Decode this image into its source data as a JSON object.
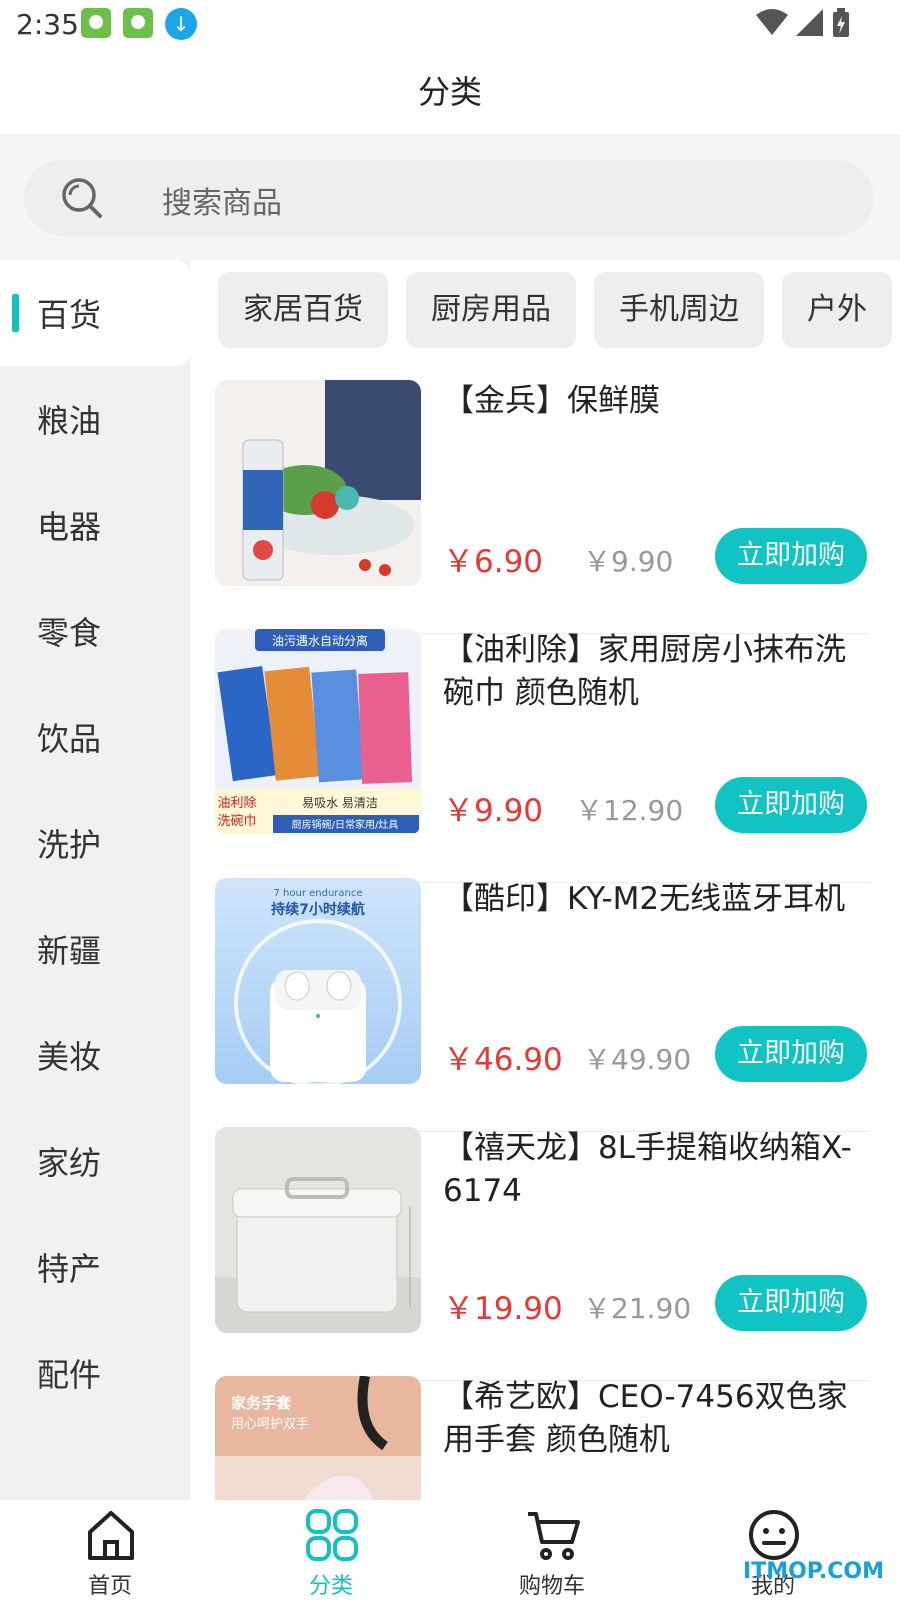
{
  "status": {
    "time": "2:35"
  },
  "header": {
    "title": "分类"
  },
  "search": {
    "placeholder": "搜索商品"
  },
  "sidebar": {
    "items": [
      {
        "label": "百货",
        "active": true
      },
      {
        "label": "粮油"
      },
      {
        "label": "电器"
      },
      {
        "label": "零食"
      },
      {
        "label": "饮品"
      },
      {
        "label": "洗护"
      },
      {
        "label": "新疆"
      },
      {
        "label": "美妆"
      },
      {
        "label": "家纺"
      },
      {
        "label": "特产"
      },
      {
        "label": "配件"
      }
    ]
  },
  "subcategories": [
    "家居百货",
    "厨房用品",
    "手机周边",
    "户外"
  ],
  "products": [
    {
      "name": "【金兵】保鲜膜",
      "price": "￥6.90",
      "original_price": "￥9.90",
      "button": "立即加购"
    },
    {
      "name": "【油利除】家用厨房小抹布洗碗巾 颜色随机",
      "price": "￥9.90",
      "original_price": "￥12.90",
      "button": "立即加购",
      "image_text": [
        "油污遇水自动分离",
        "油利除",
        "洗碗巾",
        "易吸水 易清洁",
        "厨房锅碗/日常家用/灶具"
      ]
    },
    {
      "name": "【酷印】KY-M2无线蓝牙耳机",
      "price": "￥46.90",
      "original_price": "￥49.90",
      "button": "立即加购",
      "image_text": [
        "7 hour endurance",
        "持续7小时续航"
      ]
    },
    {
      "name": "【禧天龙】8L手提箱收纳箱X-6174",
      "price": "￥19.90",
      "original_price": "￥21.90",
      "button": "立即加购"
    },
    {
      "name": "【希艺欧】CEO-7456双色家用手套 颜色随机",
      "price": "",
      "original_price": "",
      "button": "",
      "image_text": [
        "家务手套",
        "用心呵护双手"
      ]
    }
  ],
  "tabbar": {
    "items": [
      {
        "label": "首页",
        "icon": "home-icon"
      },
      {
        "label": "分类",
        "icon": "category-icon",
        "active": true
      },
      {
        "label": "购物车",
        "icon": "cart-icon"
      },
      {
        "label": "我的",
        "icon": "profile-icon"
      }
    ]
  },
  "watermark": "ITMOP.COM",
  "colors": {
    "accent": "#13c1c1",
    "price": "#e53935"
  }
}
